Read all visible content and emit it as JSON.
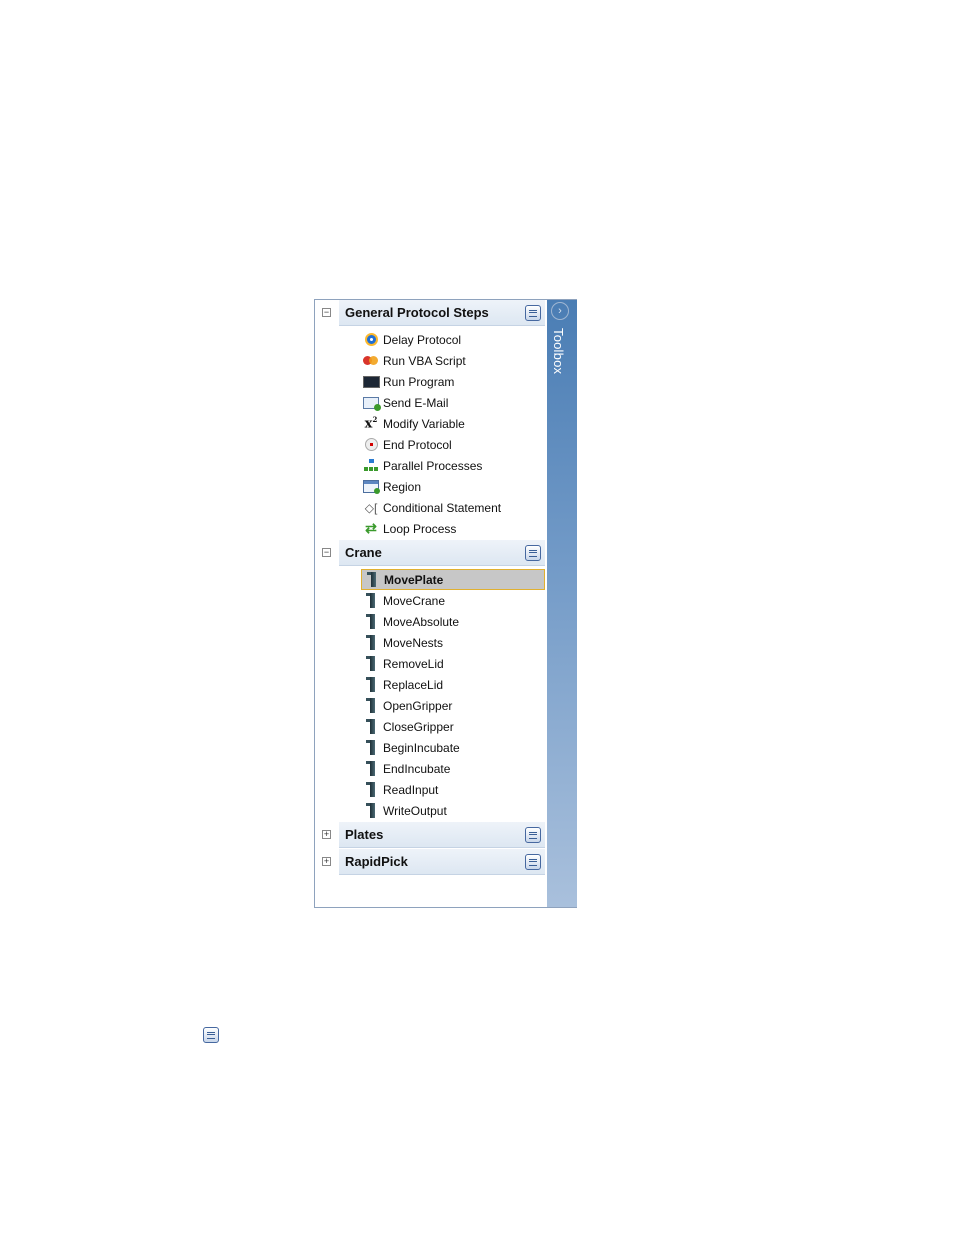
{
  "toolbox": {
    "strip_title": "Toolbox",
    "strip_button_icon": "chevron-right-icon",
    "groups": [
      {
        "title": "General Protocol Steps",
        "expander": "⊟",
        "items": [
          {
            "label": "Delay Protocol",
            "icon": "clock-icon"
          },
          {
            "label": "Run VBA Script",
            "icon": "vba-script-icon"
          },
          {
            "label": "Run Program",
            "icon": "console-icon"
          },
          {
            "label": "Send E-Mail",
            "icon": "email-icon"
          },
          {
            "label": "Modify Variable",
            "icon": "variable-icon"
          },
          {
            "label": "End Protocol",
            "icon": "stop-icon"
          },
          {
            "label": "Parallel Processes",
            "icon": "parallel-icon"
          },
          {
            "label": "Region",
            "icon": "region-icon"
          },
          {
            "label": "Conditional Statement",
            "icon": "conditional-icon"
          },
          {
            "label": "Loop Process",
            "icon": "loop-icon"
          }
        ]
      },
      {
        "title": "Crane",
        "expander": "⊟",
        "selected_item": "MovePlate",
        "items": [
          {
            "label": "MovePlate",
            "icon": "crane-icon"
          },
          {
            "label": "MoveCrane",
            "icon": "crane-icon"
          },
          {
            "label": "MoveAbsolute",
            "icon": "crane-icon"
          },
          {
            "label": "MoveNests",
            "icon": "crane-icon"
          },
          {
            "label": "RemoveLid",
            "icon": "crane-icon"
          },
          {
            "label": "ReplaceLid",
            "icon": "crane-icon"
          },
          {
            "label": "OpenGripper",
            "icon": "crane-icon"
          },
          {
            "label": "CloseGripper",
            "icon": "crane-icon"
          },
          {
            "label": "BeginIncubate",
            "icon": "crane-icon"
          },
          {
            "label": "EndIncubate",
            "icon": "crane-icon"
          },
          {
            "label": "ReadInput",
            "icon": "crane-icon"
          },
          {
            "label": "WriteOutput",
            "icon": "crane-icon"
          }
        ]
      },
      {
        "title": "Plates",
        "expander": "⊞",
        "items": []
      },
      {
        "title": "RapidPick",
        "expander": "⊞",
        "items": []
      }
    ]
  },
  "loose_icon": "group-menu-icon"
}
